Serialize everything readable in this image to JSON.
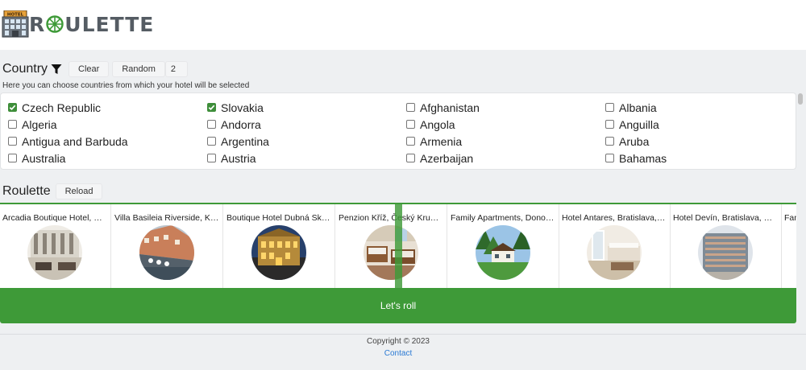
{
  "header": {
    "logo_sign": "HOTEL",
    "logo_text_prefix": "R",
    "logo_text_suffix": "ULETTE"
  },
  "country": {
    "title": "Country",
    "clear_label": "Clear",
    "random_label": "Random",
    "random_count": "2",
    "hint": "Here you can choose countries from which your hotel will be selected",
    "items": [
      {
        "name": "Czech Republic",
        "checked": true
      },
      {
        "name": "Slovakia",
        "checked": true
      },
      {
        "name": "Afghanistan",
        "checked": false
      },
      {
        "name": "Albania",
        "checked": false
      },
      {
        "name": "Algeria",
        "checked": false
      },
      {
        "name": "Andorra",
        "checked": false
      },
      {
        "name": "Angola",
        "checked": false
      },
      {
        "name": "Anguilla",
        "checked": false
      },
      {
        "name": "Antigua and Barbuda",
        "checked": false
      },
      {
        "name": "Argentina",
        "checked": false
      },
      {
        "name": "Armenia",
        "checked": false
      },
      {
        "name": "Aruba",
        "checked": false
      },
      {
        "name": "Australia",
        "checked": false
      },
      {
        "name": "Austria",
        "checked": false
      },
      {
        "name": "Azerbaijan",
        "checked": false
      },
      {
        "name": "Bahamas",
        "checked": false
      }
    ]
  },
  "roulette": {
    "title": "Roulette",
    "reload_label": "Reload",
    "cards": [
      {
        "title": "Arcadia Boutique Hotel, Bratislava, Slovakia"
      },
      {
        "title": "Villa Basileia Riverside, Karlovy Vary"
      },
      {
        "title": "Boutique Hotel Dubná Skala, Žilina"
      },
      {
        "title": "Penzion Kříž, Český Krumlov"
      },
      {
        "title": "Family Apartments, Donovaly"
      },
      {
        "title": "Hotel Antares, Bratislava, Slovakia"
      },
      {
        "title": "Hotel Devín, Bratislava, Slovakia"
      },
      {
        "title": "Family Hotel"
      }
    ],
    "roll_label": "Let's roll"
  },
  "footer": {
    "copyright": "Copyright © 2023",
    "contact": "Contact"
  },
  "colors": {
    "accent": "#3e9a38",
    "link": "#2a7ad4"
  }
}
